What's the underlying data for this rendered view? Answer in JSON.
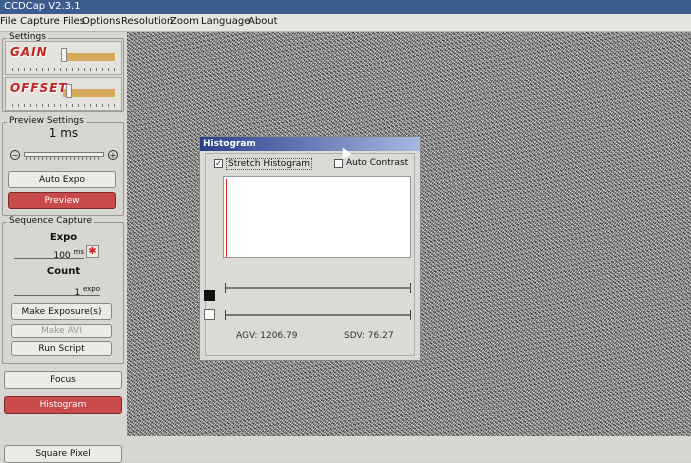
{
  "window": {
    "title": "CCDCap V2.3.1"
  },
  "menu": [
    "File",
    "Capture Files",
    "Options",
    "Resolution",
    "Zoom",
    "Language",
    "About"
  ],
  "settings": {
    "group_label": "Settings",
    "gain_label": "GAIN",
    "offset_label": "OFFSET"
  },
  "preview": {
    "group_label": "Preview Settings",
    "exposure": "1 ms",
    "auto_expo": "Auto Expo",
    "preview_button": "Preview"
  },
  "sequence": {
    "group_label": "Sequence Capture",
    "expo_label": "Expo",
    "expo_value": "100",
    "expo_unit": "ms",
    "count_label": "Count",
    "count_value": "1",
    "count_unit": "expo",
    "make_exposures": "Make Exposure(s)",
    "make_avi": "Make AVI",
    "run_script": "Run Script"
  },
  "buttons": {
    "focus": "Focus",
    "histogram": "Histogram",
    "square_pixel": "Square Pixel"
  },
  "histogram": {
    "title": "Histogram",
    "stretch_label": "Stretch Histogram",
    "stretch_checked": true,
    "auto_contrast_label": "Auto Contrast",
    "auto_contrast_checked": false,
    "agv": "AGV: 1206.79",
    "sdv": "SDV: 76.27"
  },
  "colors": {
    "accent_red": "#c94a4a",
    "title_blue": "#2a3f8a"
  }
}
